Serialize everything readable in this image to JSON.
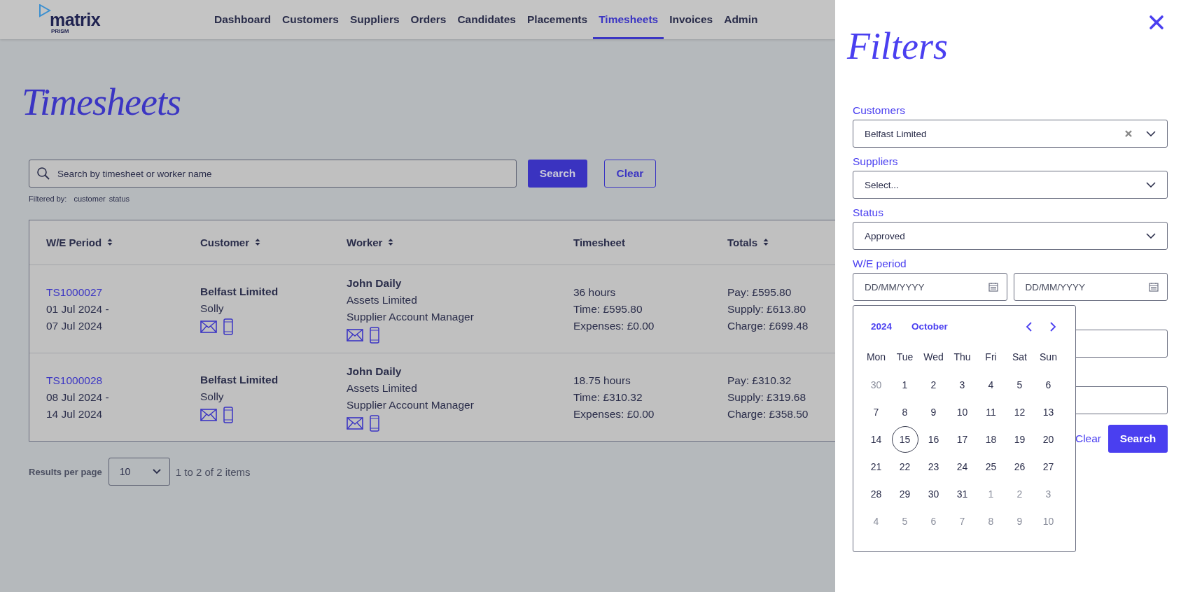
{
  "logo": {
    "name": "matrix",
    "sub": "PRISM"
  },
  "nav": [
    {
      "label": "Dashboard",
      "selected": false
    },
    {
      "label": "Customers",
      "selected": false
    },
    {
      "label": "Suppliers",
      "selected": false
    },
    {
      "label": "Orders",
      "selected": false
    },
    {
      "label": "Candidates",
      "selected": false
    },
    {
      "label": "Placements",
      "selected": false
    },
    {
      "label": "Timesheets",
      "selected": true
    },
    {
      "label": "Invoices",
      "selected": false
    },
    {
      "label": "Admin",
      "selected": false
    }
  ],
  "page_title": "Timesheets",
  "search": {
    "placeholder": "Search by timesheet or worker name",
    "button": "Search",
    "clear": "Clear"
  },
  "filtered_by": {
    "label": "Filtered by:",
    "tags": [
      "customer",
      "status"
    ]
  },
  "table": {
    "columns": [
      {
        "label": "W/E Period",
        "sortable": true
      },
      {
        "label": "Customer",
        "sortable": true
      },
      {
        "label": "Worker",
        "sortable": true
      },
      {
        "label": "Timesheet",
        "sortable": false
      },
      {
        "label": "Totals",
        "sortable": true
      }
    ],
    "rows": [
      {
        "id": "TS1000027",
        "period": [
          "01 Jul 2024 -",
          "07 Jul 2024"
        ],
        "customer": "Belfast Limited",
        "contact": "Solly",
        "worker": "John Daily",
        "worker_lines": [
          "Assets Limited",
          "Supplier Account Manager"
        ],
        "timesheet": [
          "36 hours",
          "Time: £595.80",
          "Expenses: £0.00"
        ],
        "totals": [
          "Pay: £595.80",
          "Supply: £613.80",
          "Charge: £699.48"
        ]
      },
      {
        "id": "TS1000028",
        "period": [
          "08 Jul 2024 -",
          "14 Jul 2024"
        ],
        "customer": "Belfast Limited",
        "contact": "Solly",
        "worker": "John Daily",
        "worker_lines": [
          "Assets Limited",
          "Supplier Account Manager"
        ],
        "timesheet": [
          "18.75 hours",
          "Time: £310.32",
          "Expenses: £0.00"
        ],
        "totals": [
          "Pay: £310.32",
          "Supply: £319.68",
          "Charge: £358.50"
        ]
      }
    ]
  },
  "pagination": {
    "label": "Results per page",
    "per_page": "10",
    "summary": "1 to 2 of 2 items"
  },
  "filters": {
    "title": "Filters",
    "fields": [
      {
        "label": "Customers",
        "value": "Belfast Limited",
        "clearable": true
      },
      {
        "label": "Suppliers",
        "placeholder": "Select...",
        "clearable": false
      },
      {
        "label": "Status",
        "value": "Approved",
        "clearable": false
      }
    ],
    "period": {
      "label": "W/E period",
      "from_placeholder": "DD/MM/YYYY",
      "to_placeholder": "DD/MM/YYYY"
    },
    "calendar": {
      "year": "2024",
      "month": "October",
      "weekdays": [
        "Mon",
        "Tue",
        "Wed",
        "Thu",
        "Fri",
        "Sat",
        "Sun"
      ],
      "weeks": [
        [
          {
            "day": "30",
            "muted": true,
            "today": false
          },
          {
            "day": "1",
            "muted": false,
            "today": false
          },
          {
            "day": "2",
            "muted": false,
            "today": false
          },
          {
            "day": "3",
            "muted": false,
            "today": false
          },
          {
            "day": "4",
            "muted": false,
            "today": false
          },
          {
            "day": "5",
            "muted": false,
            "today": false
          },
          {
            "day": "6",
            "muted": false,
            "today": false
          }
        ],
        [
          {
            "day": "7",
            "muted": false,
            "today": false
          },
          {
            "day": "8",
            "muted": false,
            "today": false
          },
          {
            "day": "9",
            "muted": false,
            "today": false
          },
          {
            "day": "10",
            "muted": false,
            "today": false
          },
          {
            "day": "11",
            "muted": false,
            "today": false
          },
          {
            "day": "12",
            "muted": false,
            "today": false
          },
          {
            "day": "13",
            "muted": false,
            "today": false
          }
        ],
        [
          {
            "day": "14",
            "muted": false,
            "today": false
          },
          {
            "day": "15",
            "muted": false,
            "today": true
          },
          {
            "day": "16",
            "muted": false,
            "today": false
          },
          {
            "day": "17",
            "muted": false,
            "today": false
          },
          {
            "day": "18",
            "muted": false,
            "today": false
          },
          {
            "day": "19",
            "muted": false,
            "today": false
          },
          {
            "day": "20",
            "muted": false,
            "today": false
          }
        ],
        [
          {
            "day": "21",
            "muted": false,
            "today": false
          },
          {
            "day": "22",
            "muted": false,
            "today": false
          },
          {
            "day": "23",
            "muted": false,
            "today": false
          },
          {
            "day": "24",
            "muted": false,
            "today": false
          },
          {
            "day": "25",
            "muted": false,
            "today": false
          },
          {
            "day": "26",
            "muted": false,
            "today": false
          },
          {
            "day": "27",
            "muted": false,
            "today": false
          }
        ],
        [
          {
            "day": "28",
            "muted": false,
            "today": false
          },
          {
            "day": "29",
            "muted": false,
            "today": false
          },
          {
            "day": "30",
            "muted": false,
            "today": false
          },
          {
            "day": "31",
            "muted": false,
            "today": false
          },
          {
            "day": "1",
            "muted": true,
            "today": false
          },
          {
            "day": "2",
            "muted": true,
            "today": false
          },
          {
            "day": "3",
            "muted": true,
            "today": false
          }
        ],
        [
          {
            "day": "4",
            "muted": true,
            "today": false
          },
          {
            "day": "5",
            "muted": true,
            "today": false
          },
          {
            "day": "6",
            "muted": true,
            "today": false
          },
          {
            "day": "7",
            "muted": true,
            "today": false
          },
          {
            "day": "8",
            "muted": true,
            "today": false
          },
          {
            "day": "9",
            "muted": true,
            "today": false
          },
          {
            "day": "10",
            "muted": true,
            "today": false
          }
        ]
      ]
    },
    "clear": "Clear",
    "search": "Search"
  }
}
